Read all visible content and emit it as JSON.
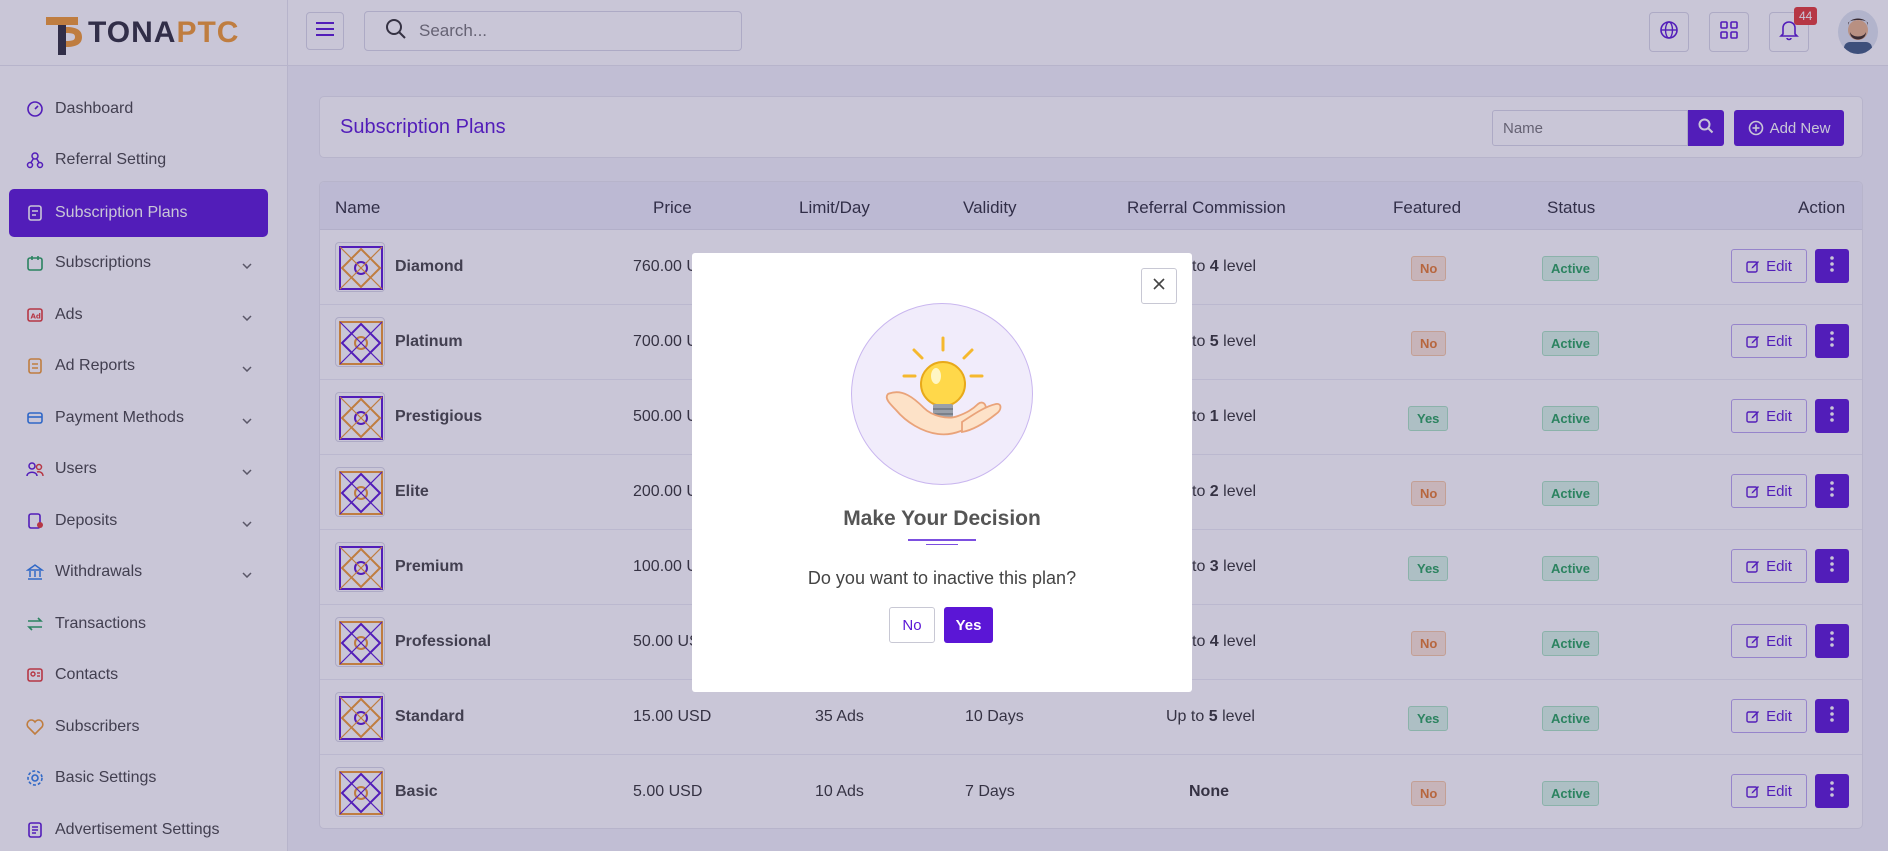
{
  "header": {
    "logo_first": "TONA",
    "logo_second": "PTC",
    "search_placeholder": "Search...",
    "notification_count": "44",
    "icons": [
      "menu-icon",
      "search-icon",
      "globe-icon",
      "apps-icon",
      "bell-icon",
      "avatar"
    ]
  },
  "sidebar": {
    "items": [
      {
        "label": "Dashboard",
        "icon": "dashboard-icon",
        "has_chevron": false
      },
      {
        "label": "Referral Setting",
        "icon": "referral-icon",
        "has_chevron": false
      },
      {
        "label": "Subscription Plans",
        "icon": "plans-icon",
        "has_chevron": false,
        "active": true
      },
      {
        "label": "Subscriptions",
        "icon": "subscriptions-icon",
        "has_chevron": true
      },
      {
        "label": "Ads",
        "icon": "ads-icon",
        "has_chevron": true
      },
      {
        "label": "Ad Reports",
        "icon": "ad-reports-icon",
        "has_chevron": true
      },
      {
        "label": "Payment Methods",
        "icon": "payment-icon",
        "has_chevron": true
      },
      {
        "label": "Users",
        "icon": "users-icon",
        "has_chevron": true
      },
      {
        "label": "Deposits",
        "icon": "deposits-icon",
        "has_chevron": true
      },
      {
        "label": "Withdrawals",
        "icon": "withdrawals-icon",
        "has_chevron": true
      },
      {
        "label": "Transactions",
        "icon": "transactions-icon",
        "has_chevron": false
      },
      {
        "label": "Contacts",
        "icon": "contacts-icon",
        "has_chevron": false
      },
      {
        "label": "Subscribers",
        "icon": "subscribers-icon",
        "has_chevron": false
      },
      {
        "label": "Basic Settings",
        "icon": "settings-icon",
        "has_chevron": false
      },
      {
        "label": "Advertisement Settings",
        "icon": "ad-settings-icon",
        "has_chevron": false
      }
    ]
  },
  "page": {
    "title": "Subscription Plans",
    "name_placeholder": "Name",
    "add_new_label": "Add New"
  },
  "table": {
    "columns": [
      "Name",
      "Price",
      "Limit/Day",
      "Validity",
      "Referral Commission",
      "Featured",
      "Status",
      "Action"
    ],
    "edit_label": "Edit",
    "rows": [
      {
        "name": "Diamond",
        "price": "760.00 U",
        "limit": "",
        "validity": "",
        "commission_prefix": "to",
        "commission_level": "4",
        "commission_suffix": "level",
        "featured": "No",
        "status": "Active"
      },
      {
        "name": "Platinum",
        "price": "700.00 U",
        "limit": "",
        "validity": "",
        "commission_prefix": "to",
        "commission_level": "5",
        "commission_suffix": "level",
        "featured": "No",
        "status": "Active"
      },
      {
        "name": "Prestigious",
        "price": "500.00 U",
        "limit": "",
        "validity": "",
        "commission_prefix": "to",
        "commission_level": "1",
        "commission_suffix": "level",
        "featured": "Yes",
        "status": "Active"
      },
      {
        "name": "Elite",
        "price": "200.00 U",
        "limit": "",
        "validity": "",
        "commission_prefix": "to",
        "commission_level": "2",
        "commission_suffix": "level",
        "featured": "No",
        "status": "Active"
      },
      {
        "name": "Premium",
        "price": "100.00 U",
        "limit": "",
        "validity": "",
        "commission_prefix": "to",
        "commission_level": "3",
        "commission_suffix": "level",
        "featured": "Yes",
        "status": "Active"
      },
      {
        "name": "Professional",
        "price": "50.00 US",
        "limit": "",
        "validity": "",
        "commission_prefix": "to",
        "commission_level": "4",
        "commission_suffix": "level",
        "featured": "No",
        "status": "Active"
      },
      {
        "name": "Standard",
        "price": "15.00 USD",
        "limit": "35 Ads",
        "validity": "10 Days",
        "commission_prefix": "Up to",
        "commission_level": "5",
        "commission_suffix": "level",
        "featured": "Yes",
        "status": "Active"
      },
      {
        "name": "Basic",
        "price": "5.00 USD",
        "limit": "10 Ads",
        "validity": "7 Days",
        "commission_prefix": "",
        "commission_level": "None",
        "commission_suffix": "",
        "featured": "No",
        "status": "Active"
      }
    ]
  },
  "modal": {
    "title": "Make Your Decision",
    "question": "Do you want to inactive this plan?",
    "no_label": "No",
    "yes_label": "Yes"
  },
  "colors": {
    "accent": "#5b16d6",
    "orange": "#f29a2e",
    "success": "#25a35a",
    "warning": "#e77b2c"
  }
}
